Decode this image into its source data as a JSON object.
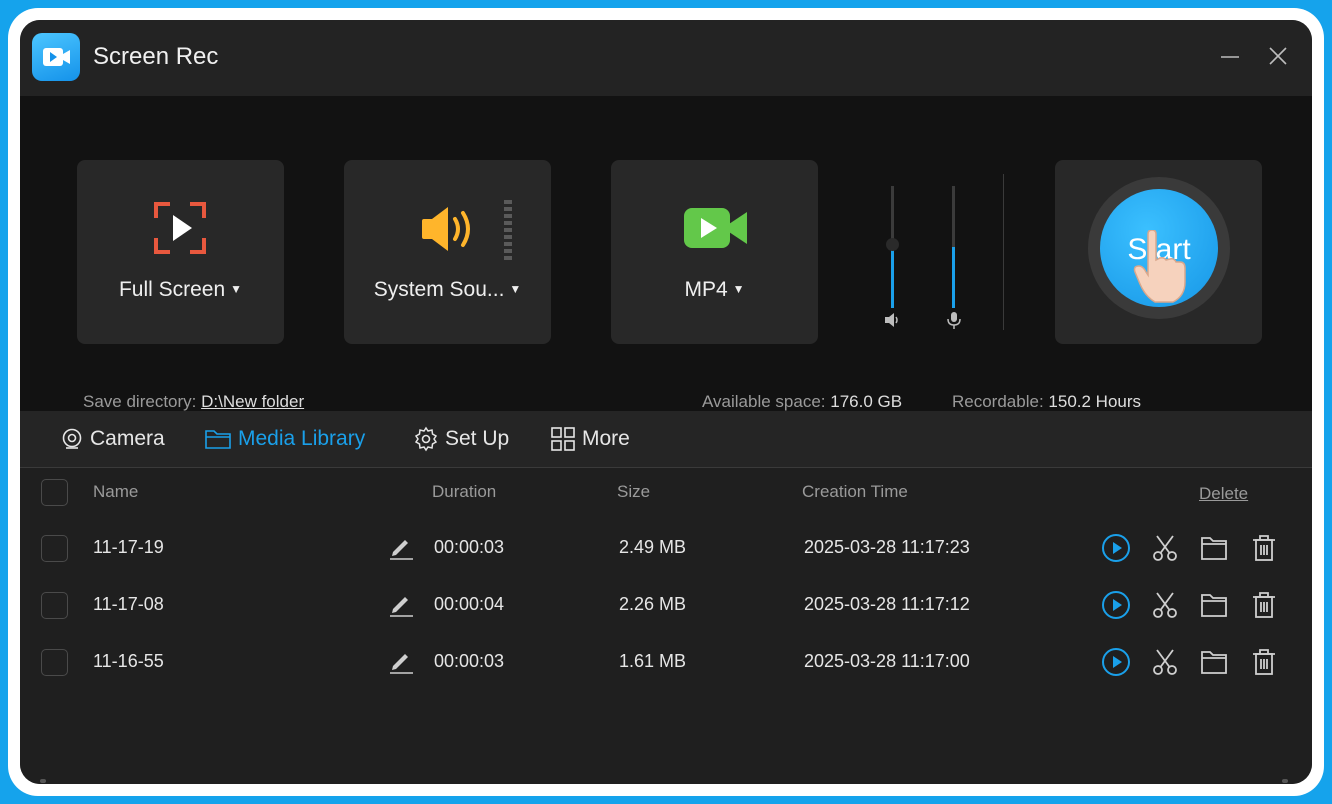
{
  "app": {
    "title": "Screen Rec"
  },
  "capture": {
    "mode_label": "Full Screen",
    "audio_label": "System Sou...",
    "format_label": "MP4",
    "speaker_volume": 0.55,
    "mic_volume": 0.5,
    "start_label": "Start"
  },
  "storage": {
    "save_dir_label": "Save directory:",
    "save_dir_value": "D:\\New folder",
    "space_label": "Available space:",
    "space_value": "176.0 GB",
    "recordable_label": "Recordable:",
    "recordable_value": "150.2 Hours"
  },
  "tabs": [
    {
      "label": "Camera",
      "icon": "camera-icon"
    },
    {
      "label": "Media Library",
      "icon": "folder-icon",
      "active": true
    },
    {
      "label": "Set Up",
      "icon": "gear-icon"
    },
    {
      "label": "More",
      "icon": "grid-icon"
    }
  ],
  "table": {
    "columns": {
      "name": "Name",
      "duration": "Duration",
      "size": "Size",
      "created": "Creation Time"
    },
    "delete_label": "Delete",
    "rows": [
      {
        "name": "11-17-19",
        "duration": "00:00:03",
        "size": "2.49 MB",
        "created": "2025-03-28 11:17:23"
      },
      {
        "name": "11-17-08",
        "duration": "00:00:04",
        "size": "2.26 MB",
        "created": "2025-03-28 11:17:12"
      },
      {
        "name": "11-16-55",
        "duration": "00:00:03",
        "size": "1.61 MB",
        "created": "2025-03-28 11:17:00"
      }
    ]
  },
  "colors": {
    "accent": "#1aa0ea",
    "background": "#202020",
    "frame": "#15a3ec"
  }
}
